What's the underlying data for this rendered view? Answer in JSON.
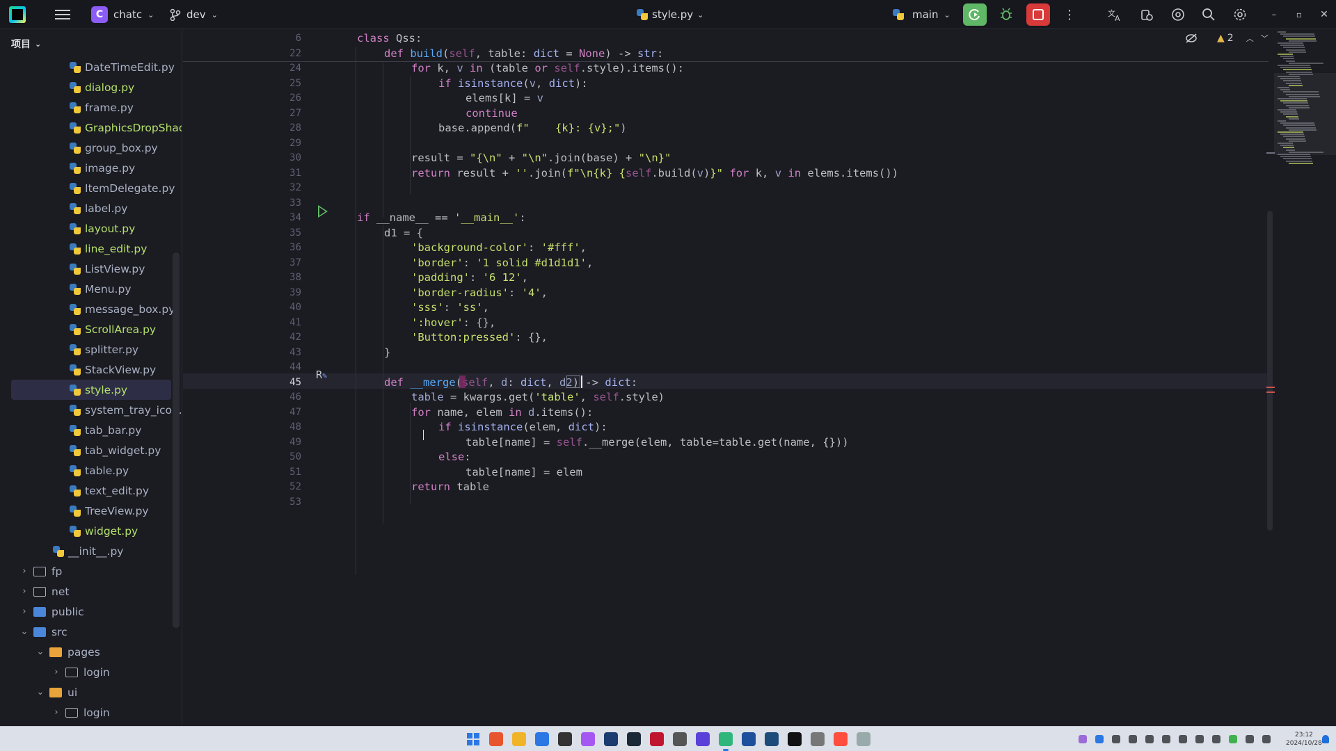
{
  "titlebar": {
    "project_badge": "C",
    "project_name": "chatc",
    "branch": "dev",
    "file_name": "style.py",
    "run_config": "main"
  },
  "project_panel": {
    "header": "项目",
    "items": [
      {
        "label": "DateTimeEdit.py",
        "type": "py",
        "depth": 2,
        "modified": false
      },
      {
        "label": "dialog.py",
        "type": "py",
        "depth": 2,
        "modified": true
      },
      {
        "label": "frame.py",
        "type": "py",
        "depth": 2,
        "modified": false
      },
      {
        "label": "GraphicsDropShad",
        "type": "py",
        "depth": 2,
        "modified": true
      },
      {
        "label": "group_box.py",
        "type": "py",
        "depth": 2,
        "modified": false
      },
      {
        "label": "image.py",
        "type": "py",
        "depth": 2,
        "modified": false
      },
      {
        "label": "ItemDelegate.py",
        "type": "py",
        "depth": 2,
        "modified": false
      },
      {
        "label": "label.py",
        "type": "py",
        "depth": 2,
        "modified": false
      },
      {
        "label": "layout.py",
        "type": "py",
        "depth": 2,
        "modified": true
      },
      {
        "label": "line_edit.py",
        "type": "py",
        "depth": 2,
        "modified": true
      },
      {
        "label": "ListView.py",
        "type": "py",
        "depth": 2,
        "modified": false
      },
      {
        "label": "Menu.py",
        "type": "py",
        "depth": 2,
        "modified": false
      },
      {
        "label": "message_box.py",
        "type": "py",
        "depth": 2,
        "modified": false
      },
      {
        "label": "ScrollArea.py",
        "type": "py",
        "depth": 2,
        "modified": true
      },
      {
        "label": "splitter.py",
        "type": "py",
        "depth": 2,
        "modified": false
      },
      {
        "label": "StackView.py",
        "type": "py",
        "depth": 2,
        "modified": false
      },
      {
        "label": "style.py",
        "type": "py",
        "depth": 2,
        "modified": true,
        "selected": true
      },
      {
        "label": "system_tray_icon.p",
        "type": "py",
        "depth": 2,
        "modified": false
      },
      {
        "label": "tab_bar.py",
        "type": "py",
        "depth": 2,
        "modified": false
      },
      {
        "label": "tab_widget.py",
        "type": "py",
        "depth": 2,
        "modified": false
      },
      {
        "label": "table.py",
        "type": "py",
        "depth": 2,
        "modified": false
      },
      {
        "label": "text_edit.py",
        "type": "py",
        "depth": 2,
        "modified": false
      },
      {
        "label": "TreeView.py",
        "type": "py",
        "depth": 2,
        "modified": false
      },
      {
        "label": "widget.py",
        "type": "py",
        "depth": 2,
        "modified": true
      },
      {
        "label": "__init__.py",
        "type": "py",
        "depth": 1,
        "modified": false
      },
      {
        "label": "fp",
        "type": "folder",
        "depth": 0,
        "expanded": false
      },
      {
        "label": "net",
        "type": "folder",
        "depth": 0,
        "expanded": false
      },
      {
        "label": "public",
        "type": "folder-blue",
        "depth": 0,
        "expanded": false
      },
      {
        "label": "src",
        "type": "folder-blue",
        "depth": 0,
        "expanded": true
      },
      {
        "label": "pages",
        "type": "folder-orange",
        "depth": 1,
        "expanded": true
      },
      {
        "label": "login",
        "type": "folder",
        "depth": 2,
        "expanded": false
      },
      {
        "label": "ui",
        "type": "folder-orange",
        "depth": 1,
        "expanded": true
      },
      {
        "label": "login",
        "type": "folder",
        "depth": 2,
        "expanded": false
      }
    ]
  },
  "editor": {
    "inspection_count": "2",
    "current_line": "45",
    "lines": [
      {
        "n": "6",
        "indent": 0,
        "html": "<span class='kw'>class</span> Qss:"
      },
      {
        "n": "22",
        "indent": 1,
        "html": "<span class='kw'>def</span> <span class='fn'>build</span>(<span class='sf'>self</span>, table: <span class='bi'>dict</span> = <span class='kw'>None</span>) -> <span class='bi'>str</span>:"
      },
      {
        "n": "24",
        "indent": 2,
        "html": "<span class='kw'>for</span> k, <span class='pm'>v</span> <span class='kw'>in</span> (table <span class='kw'>or</span> <span class='sf'>self</span>.style).items():"
      },
      {
        "n": "25",
        "indent": 3,
        "html": "<span class='kw'>if</span> <span class='bi'>isinstance</span>(<span class='pm'>v</span>, <span class='bi'>dict</span>):"
      },
      {
        "n": "26",
        "indent": 4,
        "html": "elems[k] = <span class='pm'>v</span>"
      },
      {
        "n": "27",
        "indent": 4,
        "html": "<span class='kw'>continue</span>"
      },
      {
        "n": "28",
        "indent": 3,
        "html": "base.append(<span class='st'>f\"    {k}: {v};\"</span>)"
      },
      {
        "n": "29",
        "indent": 0,
        "html": ""
      },
      {
        "n": "30",
        "indent": 2,
        "html": "result = <span class='st'>\"{\\n\"</span> + <span class='st'>\"\\n\"</span>.join(base) + <span class='st'>\"\\n}\"</span>"
      },
      {
        "n": "31",
        "indent": 2,
        "html": "<span class='kw'>return</span> result + <span class='st'>''</span>.join(<span class='st'>f\"\\n{k} {</span><span class='sf'>self</span>.build(<span class='pm'>v</span>)<span class='st'>}\"</span> <span class='kw'>for</span> k, <span class='pm'>v</span> <span class='kw'>in</span> elems.items())"
      },
      {
        "n": "32",
        "indent": 0,
        "html": ""
      },
      {
        "n": "33",
        "indent": 0,
        "html": ""
      },
      {
        "n": "34",
        "indent": 0,
        "html": "<span class='kw'>if</span> __name__ == <span class='st'>'__main__'</span>:"
      },
      {
        "n": "35",
        "indent": 1,
        "html": "d1 = {"
      },
      {
        "n": "36",
        "indent": 2,
        "html": "<span class='st'>'background-color'</span>: <span class='st'>'#fff'</span>,"
      },
      {
        "n": "37",
        "indent": 2,
        "html": "<span class='st'>'border'</span>: <span class='st'>'1 solid #d1d1d1'</span>,"
      },
      {
        "n": "38",
        "indent": 2,
        "html": "<span class='st'>'padding'</span>: <span class='st'>'6 12'</span>,"
      },
      {
        "n": "39",
        "indent": 2,
        "html": "<span class='st'>'border-radius'</span>: <span class='st'>'4'</span>,"
      },
      {
        "n": "40",
        "indent": 2,
        "html": "<span class='st'>'sss'</span>: <span class='st'>'ss'</span>,"
      },
      {
        "n": "41",
        "indent": 2,
        "html": "<span class='st'>':hover'</span>: {},"
      },
      {
        "n": "42",
        "indent": 2,
        "html": "<span class='st'>'Button:pressed'</span>: {},"
      },
      {
        "n": "43",
        "indent": 1,
        "html": "}"
      },
      {
        "n": "44",
        "indent": 0,
        "html": ""
      },
      {
        "n": "45",
        "indent": 1,
        "html": "<span class='kw'>def</span> <span class='fn'>__merge</span>(<span class='sf'>self</span>, <span class='pm'>d</span>: <span class='bi'>dict</span>, <span class='pm'>d2</span>) -> <span class='bi'>dict</span>:"
      },
      {
        "n": "46",
        "indent": 2,
        "html": "<span class='pm'>table</span> = kwargs.get(<span class='st'>'table'</span>, <span class='sf'>self</span>.style)"
      },
      {
        "n": "47",
        "indent": 2,
        "html": "<span class='kw'>for</span> name, elem <span class='kw'>in</span> <span class='pm'>d</span>.items():"
      },
      {
        "n": "48",
        "indent": 3,
        "html": "<span class='kw'>if</span> <span class='bi'>isinstance</span>(elem, <span class='bi'>dict</span>):"
      },
      {
        "n": "49",
        "indent": 4,
        "html": "table[name] = <span class='sf'>self</span>.__merge(elem, table=table.get(name, {}))"
      },
      {
        "n": "50",
        "indent": 3,
        "html": "<span class='kw'>else</span>:"
      },
      {
        "n": "51",
        "indent": 4,
        "html": "table[name] = elem"
      },
      {
        "n": "52",
        "indent": 2,
        "html": "<span class='kw'>return</span> table"
      },
      {
        "n": "53",
        "indent": 0,
        "html": ""
      }
    ]
  },
  "taskbar": {
    "time": "23:12",
    "date": "2024/10/28"
  }
}
